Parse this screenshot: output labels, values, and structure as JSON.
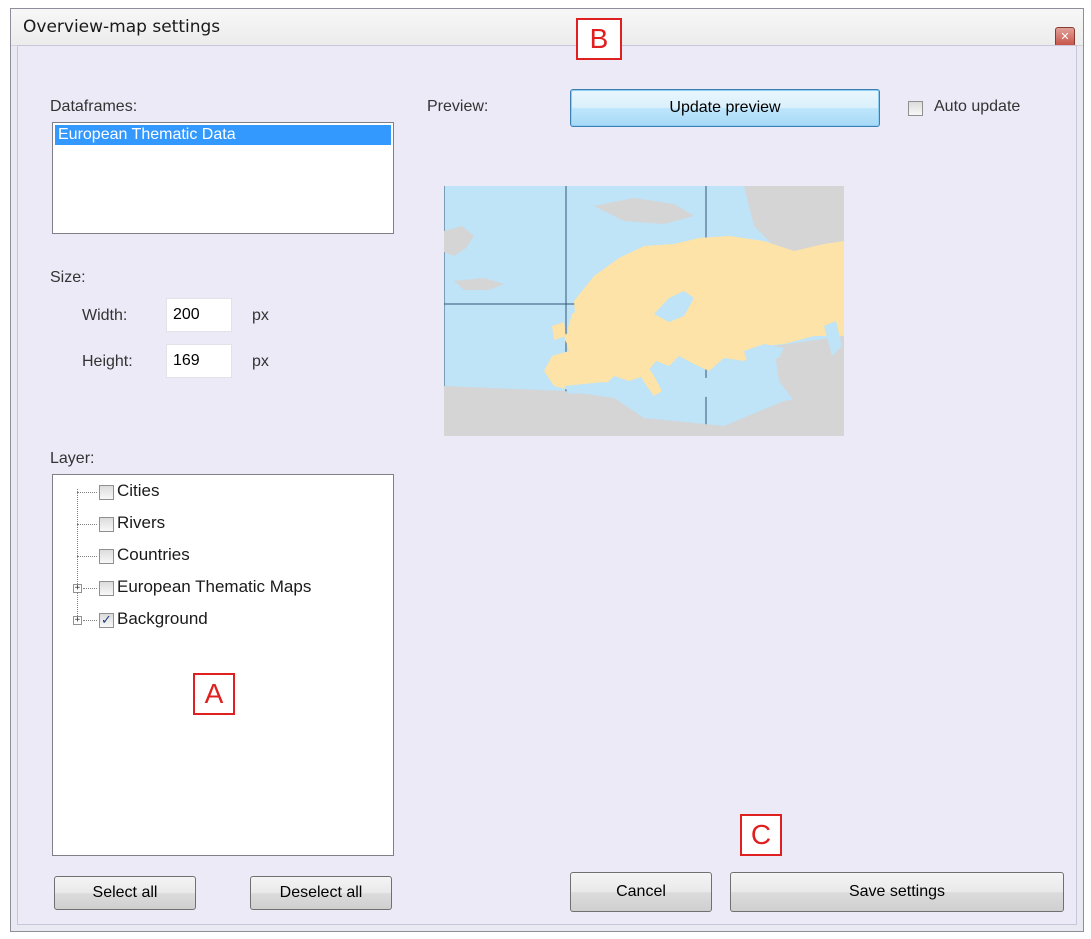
{
  "window": {
    "title": "Overview-map settings"
  },
  "labels": {
    "dataframes": "Dataframes:",
    "preview": "Preview:",
    "size": "Size:",
    "width": "Width:",
    "height": "Height:",
    "px": "px",
    "layer": "Layer:"
  },
  "dataframes": {
    "items": [
      "European Thematic Data"
    ],
    "selected": "European Thematic Data"
  },
  "size": {
    "width": "200",
    "height": "169"
  },
  "buttons": {
    "update_preview": "Update preview",
    "select_all": "Select all",
    "deselect_all": "Deselect all",
    "cancel": "Cancel",
    "save_settings": "Save settings"
  },
  "auto_update": {
    "label": "Auto update",
    "checked": false
  },
  "layers": [
    {
      "label": "Cities",
      "checked": false,
      "expandable": false
    },
    {
      "label": "Rivers",
      "checked": false,
      "expandable": false
    },
    {
      "label": "Countries",
      "checked": false,
      "expandable": false
    },
    {
      "label": "European Thematic Maps",
      "checked": false,
      "expandable": true
    },
    {
      "label": "Background",
      "checked": true,
      "expandable": true
    }
  ],
  "markers": {
    "a": "A",
    "b": "B",
    "c": "C"
  },
  "colors": {
    "sea": "#bfe3f7",
    "land": "#fde3a7",
    "other_land": "#d5d5d5",
    "selection": "#3399ff",
    "marker": "#e02020"
  }
}
